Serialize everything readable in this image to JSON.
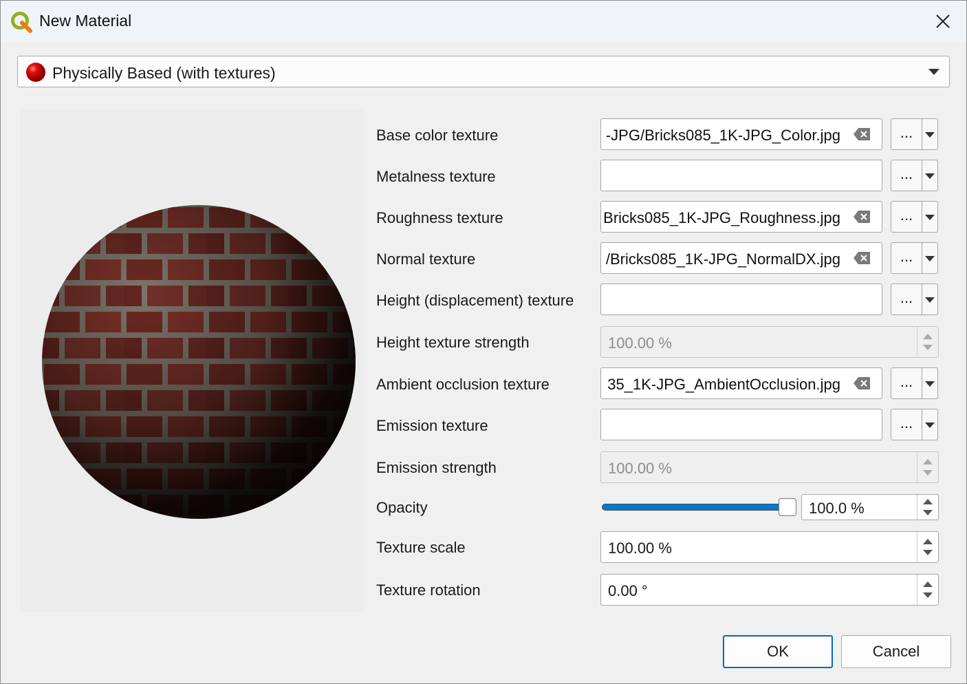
{
  "window": {
    "title": "New Material",
    "app_icon": "qgis-icon",
    "close_icon": "close-icon"
  },
  "material_type": {
    "selected": "Physically Based (with textures)",
    "icon": "red-sphere-icon"
  },
  "textures": [
    {
      "label": "Base color texture",
      "value": "-JPG/Bricks085_1K-JPG_Color.jpg"
    },
    {
      "label": "Metalness texture",
      "value": ""
    },
    {
      "label": "Roughness texture",
      "value": "Bricks085_1K-JPG_Roughness.jpg"
    },
    {
      "label": "Normal texture",
      "value": "/Bricks085_1K-JPG_NormalDX.jpg"
    },
    {
      "label": "Height (displacement) texture",
      "value": ""
    },
    {
      "label": "Ambient occlusion texture",
      "value": "35_1K-JPG_AmbientOcclusion.jpg"
    },
    {
      "label": "Emission texture",
      "value": ""
    }
  ],
  "browse_label": "...",
  "height_strength": {
    "label": "Height texture strength",
    "value": "100.00 %"
  },
  "emission_strength": {
    "label": "Emission strength",
    "value": "100.00 %"
  },
  "opacity": {
    "label": "Opacity",
    "value": "100.0 %",
    "level": 1.0
  },
  "texture_scale": {
    "label": "Texture scale",
    "value": "100.00 %"
  },
  "texture_rotation": {
    "label": "Texture rotation",
    "value": "0.00 °"
  },
  "buttons": {
    "ok": "OK",
    "cancel": "Cancel"
  },
  "colors": {
    "accent": "#0078d4",
    "default_button_border": "#0a64c8",
    "titlebar": "#eef4f7"
  }
}
